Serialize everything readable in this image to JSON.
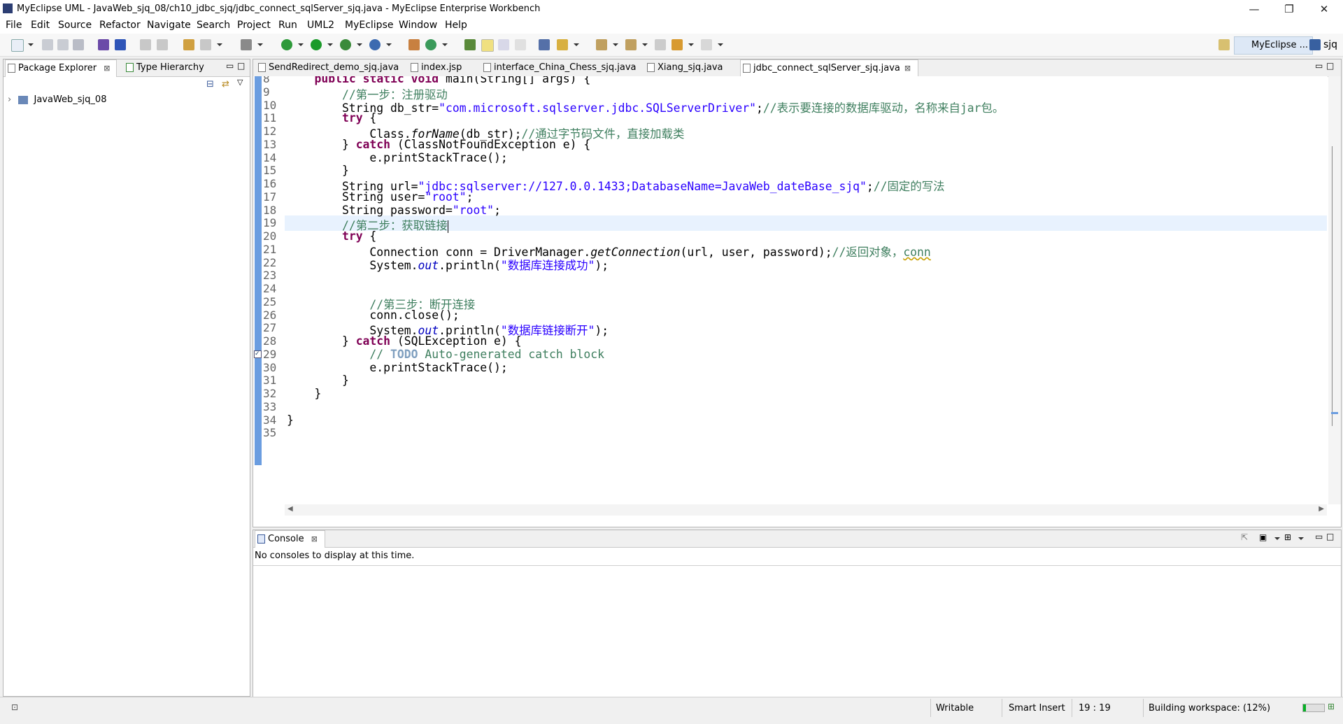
{
  "window": {
    "title": "MyEclipse UML - JavaWeb_sjq_08/ch10_jdbc_sjq/jdbc_connect_sqlServer_sjq.java - MyEclipse Enterprise Workbench",
    "minimize": "—",
    "restore": "❐",
    "close": "✕"
  },
  "menu": [
    "File",
    "Edit",
    "Source",
    "Refactor",
    "Navigate",
    "Search",
    "Project",
    "Run",
    "UML2",
    "MyEclipse",
    "Window",
    "Help"
  ],
  "toolbar": {
    "perspective_label": "MyEclipse ...",
    "user_label": "sjq"
  },
  "left_panel": {
    "tabs": [
      {
        "label": "Package Explorer",
        "close": "⊠"
      },
      {
        "label": "Type Hierarchy"
      }
    ],
    "tree": [
      {
        "label": "JavaWeb_sjq_08",
        "expander": "›"
      }
    ]
  },
  "editor": {
    "tabs": [
      {
        "label": "SendRedirect_demo_sjq.java"
      },
      {
        "label": "index.jsp"
      },
      {
        "label": "interface_China_Chess_sjq.java"
      },
      {
        "label": "Xiang_sjq.java"
      },
      {
        "label": "jdbc_connect_sqlServer_sjq.java",
        "active": true,
        "close": "⊠"
      }
    ],
    "current_line": 19,
    "lines": [
      {
        "n": "8",
        "segs": [
          [
            "",
            "    "
          ],
          [
            "kw",
            "public"
          ],
          [
            "",
            " "
          ],
          [
            "kw",
            "static"
          ],
          [
            "",
            " "
          ],
          [
            "kw",
            "void"
          ],
          [
            "",
            " main(String[] args) {"
          ]
        ]
      },
      {
        "n": "9",
        "segs": [
          [
            "",
            "        "
          ],
          [
            "cmt",
            "//第一步：注册驱动"
          ]
        ]
      },
      {
        "n": "10",
        "segs": [
          [
            "",
            "        String db_str="
          ],
          [
            "str",
            "\"com.microsoft.sqlserver.jdbc.SQLServerDriver\""
          ],
          [
            "",
            ";"
          ],
          [
            "cmt",
            "//表示要连接的数据库驱动，名称来自jar包。"
          ]
        ]
      },
      {
        "n": "11",
        "segs": [
          [
            "",
            "        "
          ],
          [
            "kw",
            "try"
          ],
          [
            "",
            " {"
          ]
        ]
      },
      {
        "n": "12",
        "segs": [
          [
            "",
            "            Class."
          ],
          [
            "it",
            "forName"
          ],
          [
            "",
            "(db_str);"
          ],
          [
            "cmt",
            "//通过字节码文件，直接加载类"
          ]
        ]
      },
      {
        "n": "13",
        "segs": [
          [
            "",
            "        } "
          ],
          [
            "kw",
            "catch"
          ],
          [
            "",
            " (ClassNotFoundException e) {"
          ]
        ]
      },
      {
        "n": "14",
        "segs": [
          [
            "",
            "            e.printStackTrace();"
          ]
        ]
      },
      {
        "n": "15",
        "segs": [
          [
            "",
            "        }"
          ]
        ]
      },
      {
        "n": "16",
        "segs": [
          [
            "",
            "        String url="
          ],
          [
            "str",
            "\"jdbc:sqlserver://127.0.0.1433;DatabaseName=JavaWeb_dateBase_sjq\""
          ],
          [
            "",
            ";"
          ],
          [
            "cmt",
            "//固定的写法"
          ]
        ]
      },
      {
        "n": "17",
        "segs": [
          [
            "",
            "        String user="
          ],
          [
            "str",
            "\"root\""
          ],
          [
            "",
            ";"
          ]
        ]
      },
      {
        "n": "18",
        "segs": [
          [
            "",
            "        String password="
          ],
          [
            "str",
            "\"root\""
          ],
          [
            "",
            ";"
          ]
        ]
      },
      {
        "n": "19",
        "segs": [
          [
            "",
            "        "
          ],
          [
            "cmt",
            "//第二步：获取链接"
          ]
        ],
        "caret": true
      },
      {
        "n": "20",
        "segs": [
          [
            "",
            "        "
          ],
          [
            "kw",
            "try"
          ],
          [
            "",
            " {"
          ]
        ]
      },
      {
        "n": "21",
        "segs": [
          [
            "",
            "            Connection conn = DriverManager."
          ],
          [
            "it",
            "getConnection"
          ],
          [
            "",
            "(url, user, password);"
          ],
          [
            "cmt",
            "//返回对象，"
          ],
          [
            "cmt warn",
            "conn"
          ]
        ]
      },
      {
        "n": "22",
        "segs": [
          [
            "",
            "            System."
          ],
          [
            "fld",
            "out"
          ],
          [
            "",
            ".println("
          ],
          [
            "str",
            "\"数据库连接成功\""
          ],
          [
            "",
            ");"
          ]
        ]
      },
      {
        "n": "23",
        "segs": [
          [
            "",
            ""
          ]
        ]
      },
      {
        "n": "24",
        "segs": [
          [
            "",
            ""
          ]
        ]
      },
      {
        "n": "25",
        "segs": [
          [
            "",
            "            "
          ],
          [
            "cmt",
            "//第三步：断开连接"
          ]
        ]
      },
      {
        "n": "26",
        "segs": [
          [
            "",
            "            conn.close();"
          ]
        ]
      },
      {
        "n": "27",
        "segs": [
          [
            "",
            "            System."
          ],
          [
            "fld",
            "out"
          ],
          [
            "",
            ".println("
          ],
          [
            "str",
            "\"数据库链接断开\""
          ],
          [
            "",
            ");"
          ]
        ]
      },
      {
        "n": "28",
        "segs": [
          [
            "",
            "        } "
          ],
          [
            "kw",
            "catch"
          ],
          [
            "",
            " (SQLException e) {"
          ]
        ]
      },
      {
        "n": "29",
        "segs": [
          [
            "",
            "            "
          ],
          [
            "cmt",
            "// "
          ],
          [
            "todo",
            "TODO"
          ],
          [
            "cmt",
            " Auto-generated catch block"
          ]
        ],
        "task": true
      },
      {
        "n": "30",
        "segs": [
          [
            "",
            "            e.printStackTrace();"
          ]
        ]
      },
      {
        "n": "31",
        "segs": [
          [
            "",
            "        }"
          ]
        ]
      },
      {
        "n": "32",
        "segs": [
          [
            "",
            "    }"
          ]
        ]
      },
      {
        "n": "33",
        "segs": [
          [
            "",
            ""
          ]
        ]
      },
      {
        "n": "34",
        "segs": [
          [
            "",
            "}"
          ]
        ]
      },
      {
        "n": "35",
        "segs": [
          [
            "",
            ""
          ]
        ]
      }
    ]
  },
  "console": {
    "tab_label": "Console",
    "tab_close": "⊠",
    "message": "No consoles to display at this time."
  },
  "status": {
    "writable": "Writable",
    "insert_mode": "Smart Insert",
    "position": "19 : 19",
    "progress_text": "Building workspace: (12%)",
    "progress": 0.12
  },
  "colors": {
    "keyword": "#7f0055",
    "string": "#2a00ff",
    "comment": "#3f7f5f",
    "change_ruler": "#6b9de0",
    "progress": "#06b025"
  }
}
